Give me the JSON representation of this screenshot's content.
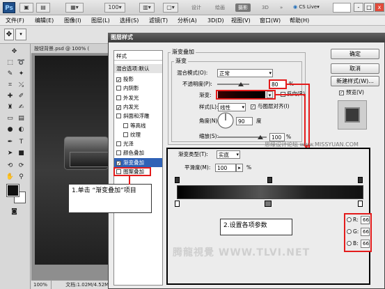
{
  "app": {
    "logo_text": "Ps",
    "workspaces": [
      "设计",
      "绘画",
      "摄影",
      "3D"
    ],
    "active_workspace": "摄影",
    "more_label": "»",
    "cs_live": "CS Live",
    "menu": [
      "文件(F)",
      "编辑(E)",
      "图像(I)",
      "图层(L)",
      "选择(S)",
      "滤镜(T)",
      "分析(A)",
      "3D(D)",
      "视图(V)",
      "窗口(W)",
      "帮助(H)"
    ],
    "window_controls": [
      "-",
      "□",
      "x"
    ]
  },
  "document": {
    "tab_title": "按钮背景.psd @ 100% (",
    "zoom": "100%",
    "doc_size": "文档:1.02M/4.52M"
  },
  "dialog": {
    "title": "图层样式",
    "styles_header": "样式",
    "blend_default": "混合选项:默认",
    "styles": [
      {
        "label": "投影",
        "checked": true
      },
      {
        "label": "内阴影",
        "checked": false
      },
      {
        "label": "外发光",
        "checked": false
      },
      {
        "label": "内发光",
        "checked": true
      },
      {
        "label": "斜面和浮雕",
        "checked": false
      },
      {
        "label": "等高线",
        "checked": false
      },
      {
        "label": "纹理",
        "checked": false
      },
      {
        "label": "光泽",
        "checked": false
      },
      {
        "label": "颜色叠加",
        "checked": false
      },
      {
        "label": "渐变叠加",
        "checked": true,
        "selected": true
      },
      {
        "label": "图案叠加",
        "checked": false
      }
    ],
    "section_title": "渐变叠加",
    "group_title": "渐变",
    "blend_mode_label": "混合模式(O):",
    "blend_mode_value": "正常",
    "opacity_label": "不透明度(P):",
    "opacity_value": "80",
    "opacity_unit": "%",
    "gradient_label": "渐变:",
    "reverse_label": "反向(R)",
    "style_label": "样式(L):",
    "style_value": "线性",
    "align_label": "与图层对齐(I)",
    "align_checked": true,
    "angle_label": "角度(N):",
    "angle_value": "90",
    "angle_unit": "度",
    "scale_label": "缩放(S):",
    "scale_value": "100",
    "scale_unit": "%",
    "buttons": {
      "ok": "确定",
      "cancel": "取消",
      "new_style": "新建样式(W)...",
      "preview": "预览(V)",
      "preview_checked": true
    }
  },
  "gradient_editor": {
    "type_label": "渐变类型(T):",
    "type_value": "实底",
    "smoothness_label": "平滑度(M):",
    "smoothness_value": "100",
    "smoothness_unit": "%",
    "rgb": [
      {
        "label": "R:",
        "value": "66"
      },
      {
        "label": "G:",
        "value": "66"
      },
      {
        "label": "B:",
        "value": "66"
      }
    ]
  },
  "callouts": {
    "step1": "1.单击 “渐变叠加”项目",
    "step2": "2.设置各项参数"
  },
  "watermarks": {
    "top": "思缘设计论坛 www.MISSYUAN.COM",
    "bottom": "腾龍視覺 WWW.TLVI.NET"
  }
}
